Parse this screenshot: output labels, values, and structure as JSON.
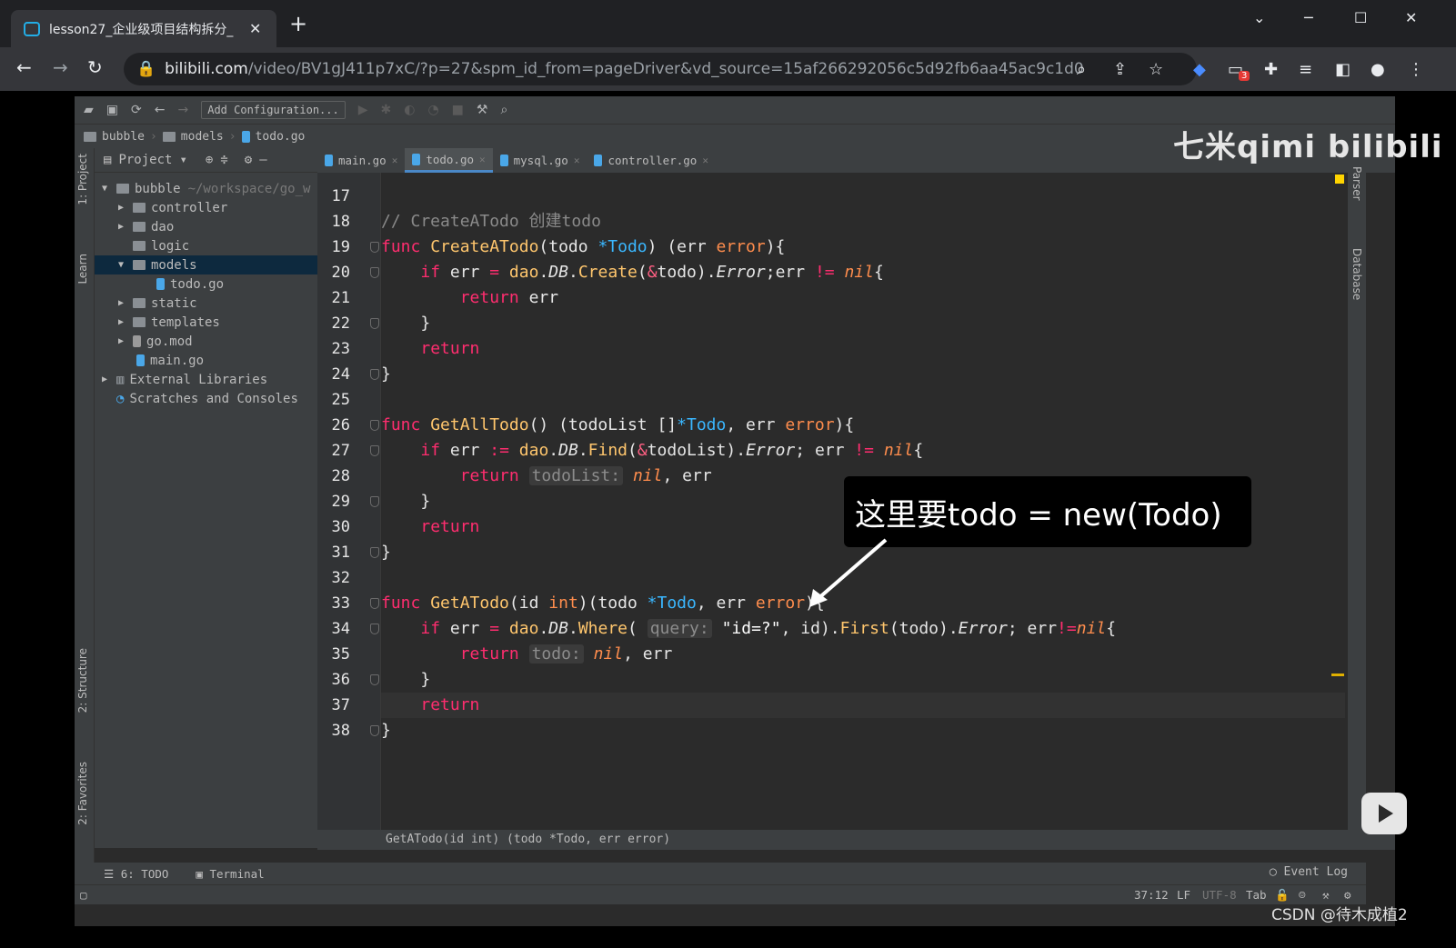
{
  "browser": {
    "tab_title": "lesson27_企业级项目结构拆分_",
    "new_tab": "+",
    "url_host": "bilibili.com",
    "url_path": "/video/BV1gJ411p7xC/?p=27&spm_id_from=pageDriver&vd_source=15af266292056c5d92fb6aa45ac9c1d0",
    "ext_badge": "3"
  },
  "ide": {
    "toolbar": {
      "add_config": "Add Configuration..."
    },
    "breadcrumb": [
      "bubble",
      "models",
      "todo.go"
    ],
    "project_label": "Project",
    "side_tabs": {
      "project": "1: Project",
      "learn": "Learn",
      "structure": "2: Structure",
      "favorites": "2: Favorites",
      "parser": "Parser",
      "database": "Database"
    },
    "tree": [
      {
        "label": "bubble",
        "extra": "~/workspace/go_w",
        "expanded": true
      },
      {
        "label": "controller"
      },
      {
        "label": "dao"
      },
      {
        "label": "logic"
      },
      {
        "label": "models",
        "selected": true
      },
      {
        "label": "todo.go"
      },
      {
        "label": "static"
      },
      {
        "label": "templates"
      },
      {
        "label": "go.mod"
      },
      {
        "label": "main.go"
      },
      {
        "label": "External Libraries"
      },
      {
        "label": "Scratches and Consoles"
      }
    ],
    "editor_tabs": [
      "main.go",
      "todo.go",
      "mysql.go",
      "controller.go"
    ],
    "active_tab": "todo.go",
    "line_numbers": [
      "17",
      "18",
      "19",
      "20",
      "21",
      "22",
      "23",
      "24",
      "25",
      "26",
      "27",
      "28",
      "29",
      "30",
      "31",
      "32",
      "33",
      "34",
      "35",
      "36",
      "37",
      "38"
    ],
    "hints": {
      "query": "query:",
      "todolist": "todoList:",
      "todo": "todo:"
    },
    "signature": "GetATodo(id int) (todo *Todo, err error)",
    "bottom_tabs": {
      "todo": "6: TODO",
      "terminal": "Terminal"
    },
    "event_log": "Event Log",
    "status": {
      "position": "37:12",
      "line_sep": "LF",
      "encoding": "UTF-8",
      "indent": "Tab"
    }
  },
  "overlay": {
    "callout": "这里要todo = new(Todo)",
    "watermark": "七米qimi  bilibili",
    "csdn": "CSDN @待木成植2"
  }
}
